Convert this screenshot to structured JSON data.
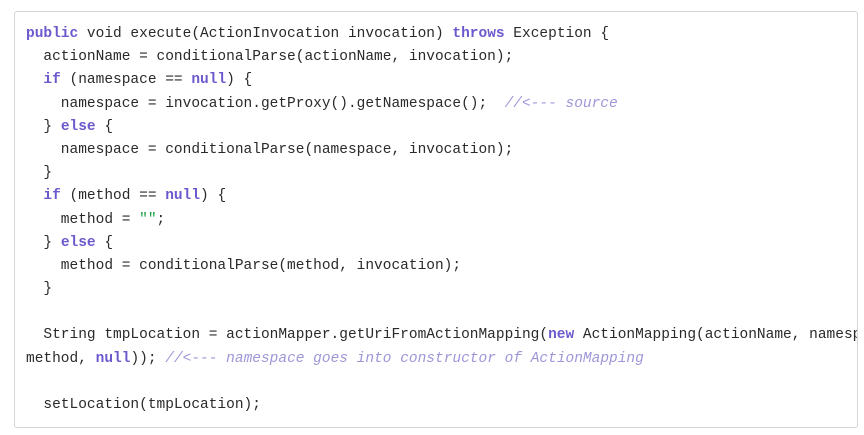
{
  "code": {
    "lines": [
      [
        {
          "t": "kw",
          "v": "public"
        },
        {
          "t": "p",
          "v": " void execute(ActionInvocation invocation) "
        },
        {
          "t": "kw",
          "v": "throws"
        },
        {
          "t": "p",
          "v": " Exception {"
        }
      ],
      [
        {
          "t": "p",
          "v": "  actionName = conditionalParse(actionName, invocation);"
        }
      ],
      [
        {
          "t": "p",
          "v": "  "
        },
        {
          "t": "kw",
          "v": "if"
        },
        {
          "t": "p",
          "v": " (namespace == "
        },
        {
          "t": "kw",
          "v": "null"
        },
        {
          "t": "p",
          "v": ") {"
        }
      ],
      [
        {
          "t": "p",
          "v": "    namespace = invocation.getProxy().getNamespace();  "
        },
        {
          "t": "cmt",
          "v": "//<--- source"
        }
      ],
      [
        {
          "t": "p",
          "v": "  } "
        },
        {
          "t": "kw",
          "v": "else"
        },
        {
          "t": "p",
          "v": " {"
        }
      ],
      [
        {
          "t": "p",
          "v": "    namespace = conditionalParse(namespace, invocation);"
        }
      ],
      [
        {
          "t": "p",
          "v": "  }"
        }
      ],
      [
        {
          "t": "p",
          "v": "  "
        },
        {
          "t": "kw",
          "v": "if"
        },
        {
          "t": "p",
          "v": " (method == "
        },
        {
          "t": "kw",
          "v": "null"
        },
        {
          "t": "p",
          "v": ") {"
        }
      ],
      [
        {
          "t": "p",
          "v": "    method = "
        },
        {
          "t": "str",
          "v": "\"\""
        },
        {
          "t": "p",
          "v": ";"
        }
      ],
      [
        {
          "t": "p",
          "v": "  } "
        },
        {
          "t": "kw",
          "v": "else"
        },
        {
          "t": "p",
          "v": " {"
        }
      ],
      [
        {
          "t": "p",
          "v": "    method = conditionalParse(method, invocation);"
        }
      ],
      [
        {
          "t": "p",
          "v": "  }"
        }
      ],
      [],
      [
        {
          "t": "p",
          "v": "  String tmpLocation = actionMapper.getUriFromActionMapping("
        },
        {
          "t": "kw",
          "v": "new"
        },
        {
          "t": "p",
          "v": " ActionMapping(actionName, namespace,"
        }
      ],
      [
        {
          "t": "p",
          "v": "method, "
        },
        {
          "t": "kw",
          "v": "null"
        },
        {
          "t": "p",
          "v": ")); "
        },
        {
          "t": "cmt",
          "v": "//<--- namespace goes into constructor of ActionMapping"
        }
      ],
      [],
      [
        {
          "t": "p",
          "v": "  setLocation(tmpLocation);"
        }
      ]
    ]
  }
}
